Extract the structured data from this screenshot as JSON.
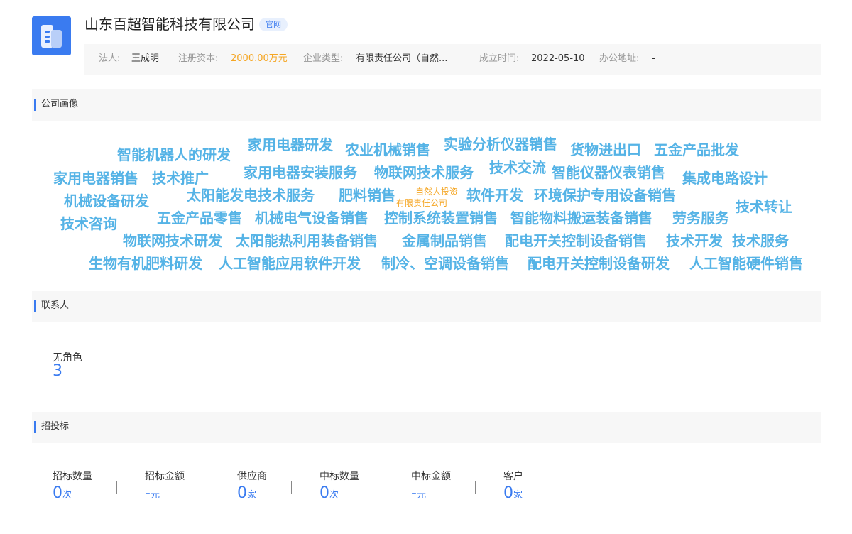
{
  "header": {
    "company_name": "山东百超智能科技有限公司",
    "official_badge": "官网",
    "info": {
      "legal_person_label": "法人:",
      "legal_person_value": "王成明",
      "capital_label": "注册资本:",
      "capital_value": "2000.00万元",
      "type_label": "企业类型:",
      "type_value": "有限责任公司（自然...",
      "founded_label": "成立时间:",
      "founded_value": "2022-05-10",
      "address_label": "办公地址:",
      "address_value": "-"
    }
  },
  "sections": {
    "profile": "公司画像",
    "contacts": "联系人",
    "bidding": "招投标"
  },
  "word_cloud": {
    "words": [
      "智能机器人的研发",
      "家用电器研发",
      "农业机械销售",
      "实验分析仪器销售",
      "货物进出口",
      "五金产品批发",
      "家用电器销售",
      "技术推广",
      "家用电器安装服务",
      "物联网技术服务",
      "技术交流",
      "智能仪器仪表销售",
      "集成电路设计",
      "机械设备研发",
      "太阳能发电技术服务",
      "肥料销售",
      "自然人投资",
      "有限责任公司",
      "软件开发",
      "环境保护专用设备销售",
      "技术转让",
      "技术咨询",
      "五金产品零售",
      "机械电气设备销售",
      "控制系统装置销售",
      "智能物料搬运装备销售",
      "劳务服务",
      "物联网技术研发",
      "太阳能热利用装备销售",
      "金属制品销售",
      "配电开关控制设备销售",
      "技术开发",
      "技术服务",
      "生物有机肥料研发",
      "人工智能应用软件开发",
      "制冷、空调设备销售",
      "配电开关控制设备研发",
      "人工智能硬件销售"
    ]
  },
  "contacts": {
    "label": "无角色",
    "count": "3"
  },
  "bidding": {
    "stats": [
      {
        "label": "招标数量",
        "value": "0",
        "unit": "次"
      },
      {
        "label": "招标金额",
        "value": "-",
        "unit": "元"
      },
      {
        "label": "供应商",
        "value": "0",
        "unit": "家"
      },
      {
        "label": "中标数量",
        "value": "0",
        "unit": "次"
      },
      {
        "label": "中标金额",
        "value": "-",
        "unit": "元"
      },
      {
        "label": "客户",
        "value": "0",
        "unit": "家"
      }
    ]
  },
  "colors": {
    "accent": "#3a7bf0",
    "cloud_word": "#55b3e6",
    "highlight": "#f5a623"
  }
}
